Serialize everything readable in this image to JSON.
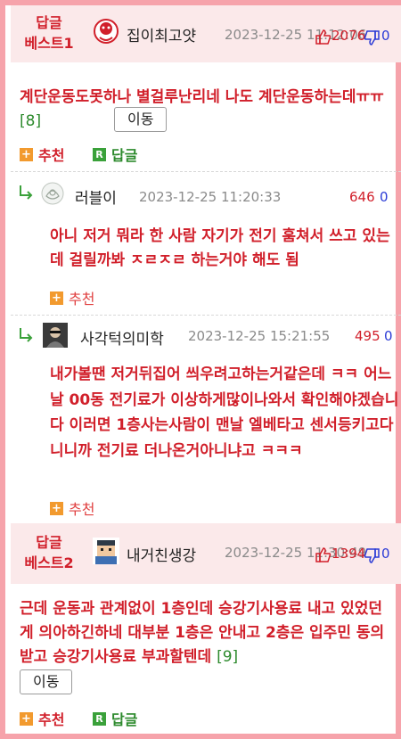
{
  "comments": [
    {
      "badge_line1": "답글",
      "badge_line2": "베스트1",
      "username": "집이최고얏",
      "date": "2023-12-25 11:12:06",
      "up": "2076",
      "down": "0",
      "text": "계단운동도못하나 별걸루난리네 나도 계단운동하는데ㅠㅠ",
      "reply_count": "[8]",
      "move_label": "이동",
      "recommend_label": "추천",
      "reply_label": "답글"
    },
    {
      "username": "러블이",
      "date": "2023-12-25 11:20:33",
      "up": "646",
      "down": "0",
      "text": "아니 저거 뭐라 한 사람 자기가 전기 훔쳐서 쓰고 있는데 걸릴까봐 ㅈㄹㅈㄹ 하는거야 해도 됨",
      "recommend_label": "추천"
    },
    {
      "username": "사각턱의미학",
      "date": "2023-12-25 15:21:55",
      "up": "495",
      "down": "0",
      "text": "내가볼땐 저거뒤집어 씌우려고하는거같은데 ㅋㅋ 어느날 00동 전기료가 이상하게많이나와서 확인해야겠습니다 이러면 1층사는사람이 맨날 엘베타고 센서등키고다니니까 전기료 더나온거아니냐고 ㅋㅋㅋ",
      "recommend_label": "추천"
    },
    {
      "badge_line1": "답글",
      "badge_line2": "베스트2",
      "username": "내거친생강",
      "date": "2023-12-25 11:30:49",
      "up": "1394",
      "down": "0",
      "text": "근데 운동과 관계없이 1층인데 승강기사용료 내고 있었던게 의아하긴하네 대부분 1층은 안내고 2층은 입주민 동의 받고 승강기사용료 부과할텐데",
      "reply_count": "[9]",
      "move_label": "이동",
      "recommend_label": "추천",
      "reply_label": "답글"
    }
  ],
  "colors": {
    "border": "#f6a3ab",
    "header_bg": "#fbe9ea",
    "accent_red": "#d11f2a",
    "blue": "#2b3bd6",
    "green": "#2d8a2d"
  }
}
